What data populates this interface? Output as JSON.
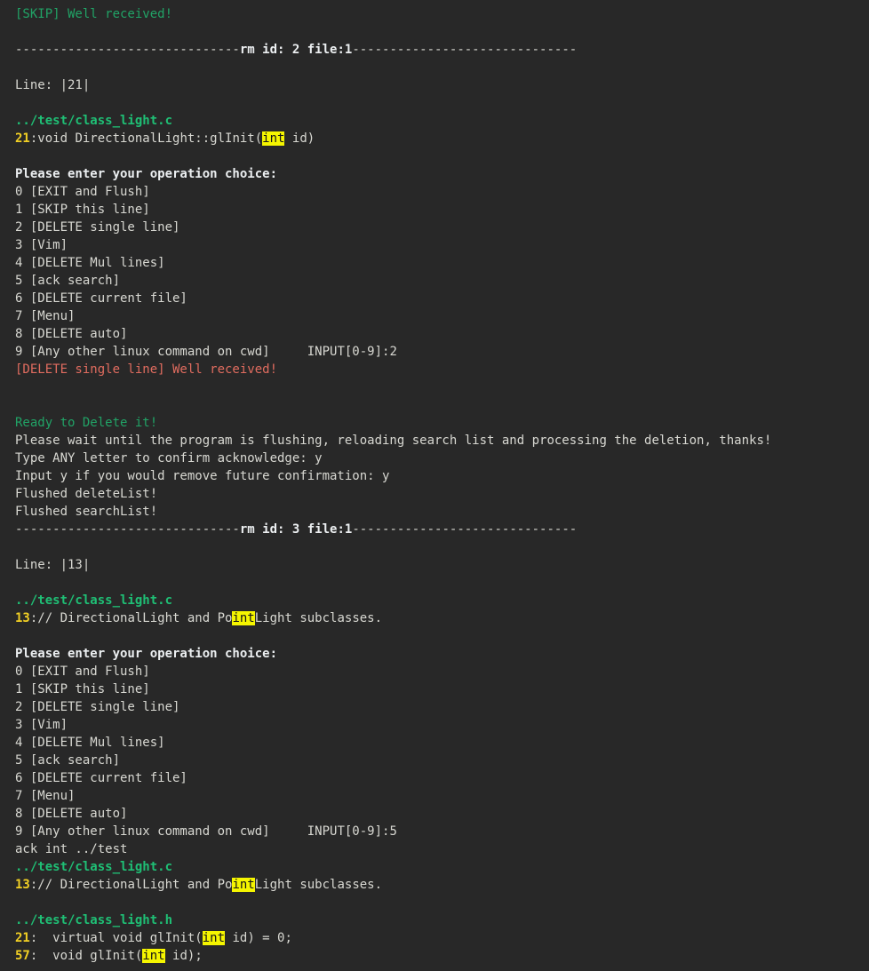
{
  "terminal": {
    "background_color": "#282828",
    "foreground_color": "#d8d8d2",
    "colors": {
      "green": "#21a366",
      "green_bold": "#1fbf75",
      "red": "#e06c5f",
      "yellow_bold": "#f2d024",
      "highlight_bg": "#f5f500",
      "highlight_fg": "#161616"
    }
  },
  "session": {
    "skip_ack": "[SKIP] Well received!",
    "separator_1": "------------------------------rm id: 2 file:1------------------------------",
    "separator_1_left": "------------------------------",
    "separator_1_mid": "rm id: 2 file:1",
    "separator_1_right": "------------------------------",
    "separator_2_left": "------------------------------",
    "separator_2_mid": "rm id: 3 file:1",
    "separator_2_right": "------------------------------",
    "line_label_1": "Line: |21|",
    "line_label_2": "Line: |13|",
    "file_c": "../test/class_light.c",
    "file_h": "../test/class_light.h",
    "match_1": {
      "lineno": "21",
      "colon": ":",
      "before": "void DirectionalLight::glInit(",
      "highlight": "int",
      "after": " id)"
    },
    "match_2": {
      "lineno": "13",
      "colon": ":",
      "before": "// DirectionalLight and Po",
      "highlight": "int",
      "after": "Light subclasses."
    },
    "match_3": {
      "lineno": "13",
      "colon": ":",
      "before": "// DirectionalLight and Po",
      "highlight": "int",
      "after": "Light subclasses."
    },
    "match_4": {
      "lineno": "21",
      "colon": ":",
      "before": "  virtual void glInit(",
      "highlight": "int",
      "after": " id) = 0;"
    },
    "match_5": {
      "lineno": "57",
      "colon": ":",
      "before": "  void glInit(",
      "highlight": "int",
      "after": " id);"
    },
    "prompt_heading": "Please enter your operation choice:",
    "menu_options": [
      "0 [EXIT and Flush]",
      "1 [SKIP this line]",
      "2 [DELETE single line]",
      "3 [Vim]",
      "4 [DELETE Mul lines]",
      "5 [ack search]",
      "6 [DELETE current file]",
      "7 [Menu]",
      "8 [DELETE auto]"
    ],
    "menu_last_label": "9 [Any other linux command on cwd]",
    "input_prompt_label": "INPUT[0-9]:",
    "input_value_1": "2",
    "input_value_2": "5",
    "delete_ack": "[DELETE single line] Well received!",
    "ready_to_delete": "Ready to Delete it!",
    "please_wait": "Please wait until the program is flushing, reloading search list and processing the deletion, thanks!",
    "confirm_prompt": "Type ANY letter to confirm acknowledge: ",
    "confirm_value": "y",
    "future_confirm_prompt": "Input y if you would remove future confirmation: ",
    "future_confirm_value": "y",
    "flushed_delete": "Flushed deleteList!",
    "flushed_search": "Flushed searchList!",
    "ack_command": "ack int ../test"
  }
}
